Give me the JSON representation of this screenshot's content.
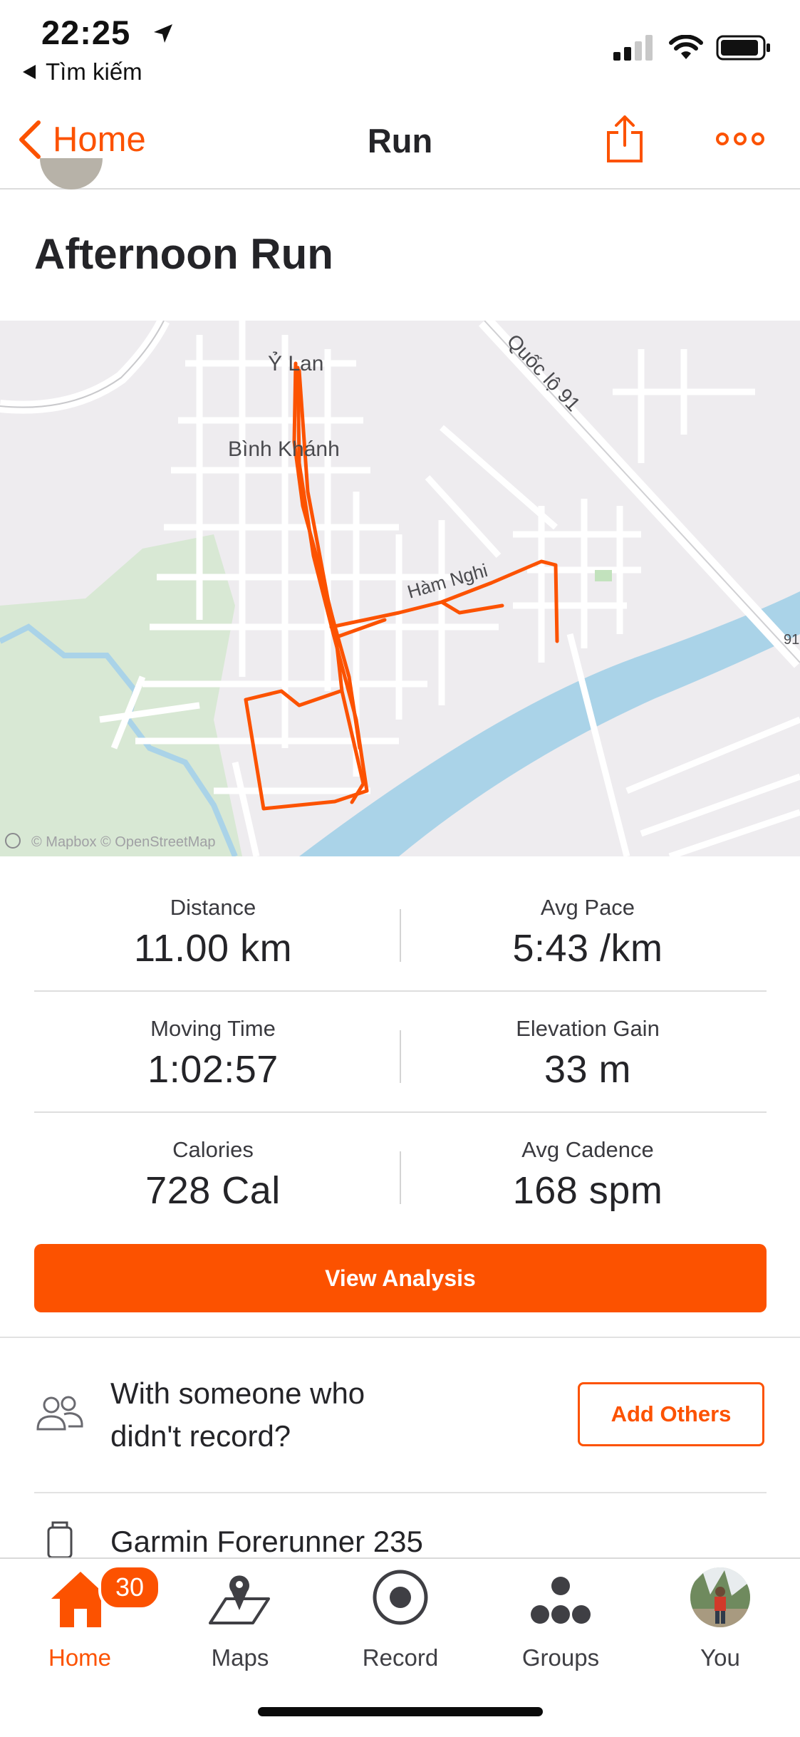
{
  "status_bar": {
    "time": "22:25",
    "back_app_label": "Tìm kiếm"
  },
  "nav": {
    "back_label": "Home",
    "title": "Run",
    "share_icon": "share-icon",
    "more_icon": "more-horizontal-icon"
  },
  "activity": {
    "title": "Afternoon Run"
  },
  "map": {
    "labels": [
      "Ỷ Lan",
      "Bình Khánh",
      "Quốc lộ 91",
      "Hàm Nghi",
      "91"
    ],
    "attribution": "© Mapbox © OpenStreetMap",
    "route_color": "#fc5200",
    "water_color": "#aad3e8",
    "park_color": "#d8e8d4"
  },
  "stats": [
    {
      "label": "Distance",
      "value": "11.00 km"
    },
    {
      "label": "Avg Pace",
      "value": "5:43 /km"
    },
    {
      "label": "Moving Time",
      "value": "1:02:57"
    },
    {
      "label": "Elevation Gain",
      "value": "33 m"
    },
    {
      "label": "Calories",
      "value": "728 Cal"
    },
    {
      "label": "Avg Cadence",
      "value": "168 spm"
    }
  ],
  "actions": {
    "view_analysis": "View Analysis",
    "with_others_text": "With someone who didn't record?",
    "add_others": "Add Others"
  },
  "device": {
    "name": "Garmin Forerunner 235"
  },
  "tabbar": {
    "badge": "30",
    "items": [
      {
        "label": "Home",
        "icon": "home-icon",
        "active": true
      },
      {
        "label": "Maps",
        "icon": "map-pin-icon",
        "active": false
      },
      {
        "label": "Record",
        "icon": "record-icon",
        "active": false
      },
      {
        "label": "Groups",
        "icon": "groups-icon",
        "active": false
      },
      {
        "label": "You",
        "icon": "profile-avatar",
        "active": false
      }
    ]
  },
  "colors": {
    "accent": "#fc5200",
    "text": "#242428"
  }
}
